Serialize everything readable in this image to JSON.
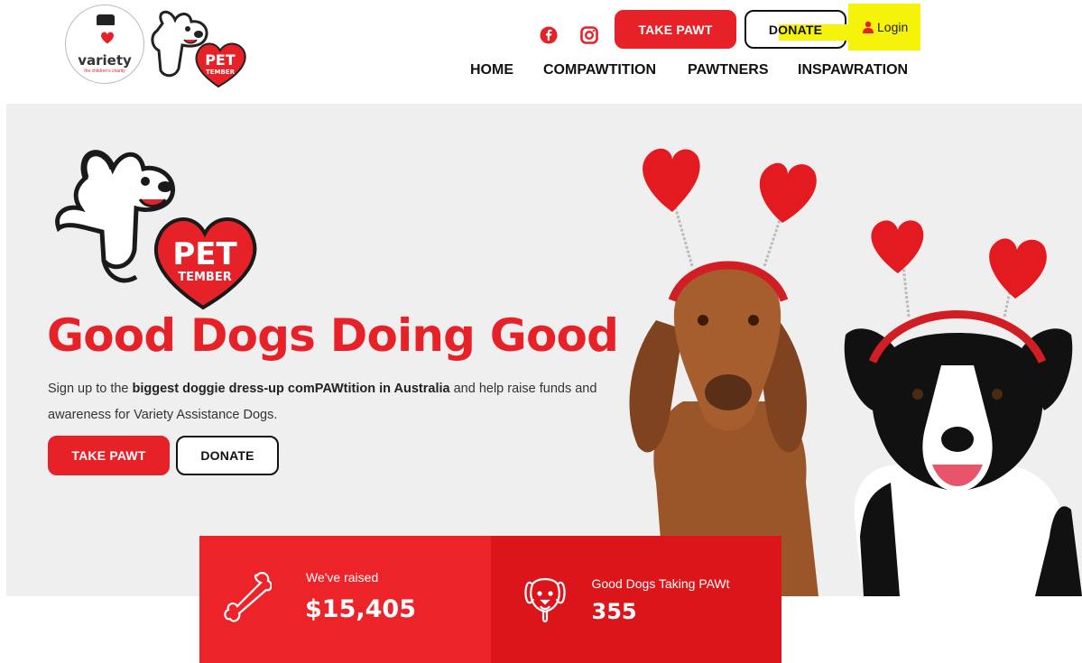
{
  "header": {
    "variety_logo": {
      "word": "variety",
      "tagline": "the children's charity"
    },
    "pet_logo_text": {
      "line1": "PET",
      "line2": "TEMBER"
    },
    "social": [
      "facebook-icon",
      "instagram-icon"
    ],
    "take_pawt_label": "TAKE PAWT",
    "donate_label": "DONATE",
    "login_label": "Login",
    "nav": [
      "HOME",
      "COMPAWTITION",
      "PAWTNERS",
      "INSPAWRATION"
    ]
  },
  "hero": {
    "logo_text": {
      "line1": "PET",
      "line2": "TEMBER"
    },
    "headline": "Good Dogs Doing Good",
    "intro_before": "Sign up to the ",
    "intro_bold": "biggest doggie dress-up comPAWtition in Australia",
    "intro_after": " and help raise funds and awareness for Variety Assistance Dogs.",
    "take_pawt_label": "TAKE PAWT",
    "donate_label": "DONATE"
  },
  "stats": [
    {
      "label": "We've raised",
      "value": "$15,405",
      "icon": "bone-icon"
    },
    {
      "label": "Good Dogs Taking PAWt",
      "value": "355",
      "icon": "dog-face-icon"
    }
  ],
  "colors": {
    "brand_red": "#e62128",
    "highlight": "#f6f30a",
    "hero_bg": "#efefef"
  }
}
